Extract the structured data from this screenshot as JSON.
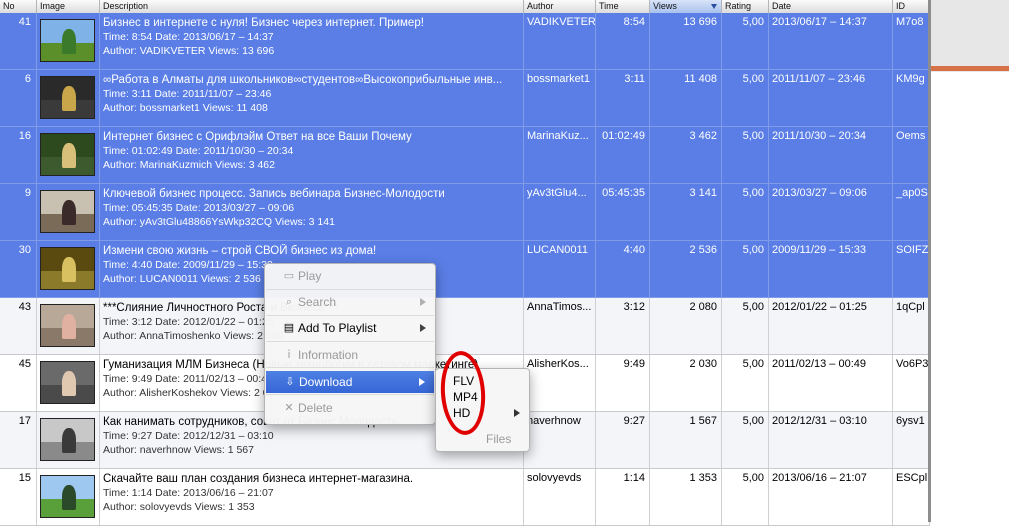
{
  "columns": {
    "no": "No",
    "image": "Image",
    "description": "Description",
    "author": "Author",
    "time": "Time",
    "views": "Views",
    "rating": "Rating",
    "date": "Date",
    "id": "ID"
  },
  "rows": [
    {
      "no": "41",
      "title": "Бизнес в интернете с нуля! Бизнес через интернет. Пример!",
      "meta": "Time: 8:54  Date: 2013/06/17 – 14:37",
      "meta2": "Author: VADIKVETER  Views: 13 696",
      "author": "VADIKVETER",
      "time": "8:54",
      "views": "13 696",
      "rating": "5,00",
      "date": "2013/06/17 – 14:37",
      "id": "M7o8",
      "selected": true
    },
    {
      "no": "6",
      "title": "∞Работа в Алматы для школьников∞студентов∞Высокоприбыльные инв...",
      "meta": "Time: 3:11  Date: 2011/11/07 – 23:46",
      "meta2": "Author: bossmarket1  Views: 11 408",
      "author": "bossmarket1",
      "time": "3:11",
      "views": "11 408",
      "rating": "5,00",
      "date": "2011/11/07 – 23:46",
      "id": "KM9g",
      "selected": true
    },
    {
      "no": "16",
      "title": "Интернет бизнес с Орифлэйм  Ответ на все Ваши Почему",
      "meta": "Time: 01:02:49  Date: 2011/10/30 – 20:34",
      "meta2": "Author: MarinaKuzmich  Views: 3 462",
      "author": "MarinaKuz...",
      "time": "01:02:49",
      "views": "3 462",
      "rating": "5,00",
      "date": "2011/10/30 – 20:34",
      "id": "Oems",
      "selected": true
    },
    {
      "no": "9",
      "title": "Ключевой бизнес процесс. Запись вебинара Бизнес-Молодости",
      "meta": "Time: 05:45:35  Date: 2013/03/27 – 09:06",
      "meta2": "Author: yAv3tGlu48866YsWkp32CQ  Views: 3 141",
      "author": "yAv3tGlu4...",
      "time": "05:45:35",
      "views": "3 141",
      "rating": "5,00",
      "date": "2013/03/27 – 09:06",
      "id": "_ap0S",
      "selected": true
    },
    {
      "no": "30",
      "title": "Измени свою жизнь – строй СВОЙ бизнес из дома!",
      "meta": "Time: 4:40  Date: 2009/11/29 – 15:33",
      "meta2": "Author: LUCAN0011  Views: 2 536",
      "author": "LUCAN0011",
      "time": "4:40",
      "views": "2 536",
      "rating": "5,00",
      "date": "2009/11/29 – 15:33",
      "id": "SOIFZ",
      "selected": true
    },
    {
      "no": "43",
      "title": "***Слияние Личностного Роста и Бизнеса***",
      "meta": "Time: 3:12  Date: 2012/01/22 – 01:25",
      "meta2": "Author: AnnaTimoshenko  Views: 2 080",
      "author": "AnnaTimos...",
      "time": "3:12",
      "views": "2 080",
      "rating": "5,00",
      "date": "2012/01/22 – 01:25",
      "id": "1qCpl",
      "selected": false
    },
    {
      "no": "45",
      "title": "Гуманизация МЛМ Бизнеса (Новые технологии в сетевом маркетинге)",
      "meta": "Time: 9:49  Date: 2011/02/13 – 00:49",
      "meta2": "Author: AlisherKoshekov  Views: 2 030",
      "author": "AlisherKos...",
      "time": "9:49",
      "views": "2 030",
      "rating": "5,00",
      "date": "2011/02/13 – 00:49",
      "id": "Vo6P3",
      "selected": false
    },
    {
      "no": "17",
      "title": "Как нанимать сотрудников, совет от Бизнес Молодость",
      "meta": "Time: 9:27  Date: 2012/12/31 – 03:10",
      "meta2": "Author: naverhnow  Views: 1 567",
      "author": "naverhnow",
      "time": "9:27",
      "views": "1 567",
      "rating": "5,00",
      "date": "2012/12/31 – 03:10",
      "id": "6ysv1",
      "selected": false
    },
    {
      "no": "15",
      "title": "Скачайте ваш план создания бизнеса интернет-магазина.",
      "meta": "Time: 1:14  Date: 2013/06/16 – 21:07",
      "meta2": "Author: solovyevds  Views: 1 353",
      "author": "solovyevds",
      "time": "1:14",
      "views": "1 353",
      "rating": "5,00",
      "date": "2013/06/16 – 21:07",
      "id": "ESCpl",
      "selected": false
    }
  ],
  "context_menu": {
    "play": "Play",
    "search": "Search",
    "add_to_playlist": "Add To Playlist",
    "information": "Information",
    "download": "Download",
    "delete": "Delete"
  },
  "download_submenu": {
    "flv": "FLV",
    "mp4": "MP4",
    "hd": "HD",
    "files": "Files"
  },
  "colors": {
    "selection": "#5a7ee6",
    "highlight": "#3566d6",
    "annotation_circle": "#e00000"
  }
}
